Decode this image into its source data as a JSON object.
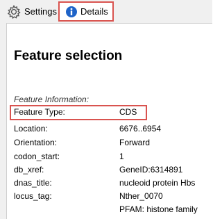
{
  "tabs": {
    "settings_label": "Settings",
    "details_label": "Details",
    "settings_icon": "gear-icon",
    "details_icon": "info-icon"
  },
  "panel": {
    "title": "Feature selection",
    "section_title": "Feature Information:",
    "rows": [
      {
        "key": "Feature Type:",
        "value": "CDS"
      },
      {
        "key": "Location:",
        "value": "6676..6954"
      },
      {
        "key": "Orientation:",
        "value": "Forward"
      },
      {
        "key": "codon_start:",
        "value": "1"
      },
      {
        "key": "db_xref:",
        "value": "GeneID:6314891"
      },
      {
        "key": "dnas_title:",
        "value": "nucleoid protein Hbs"
      },
      {
        "key": "locus_tag:",
        "value": "Nther_0070"
      }
    ],
    "continuation": "PFAM: histone family"
  },
  "colors": {
    "highlight": "#d9534f",
    "info_icon_blue": "#1e63c8"
  }
}
